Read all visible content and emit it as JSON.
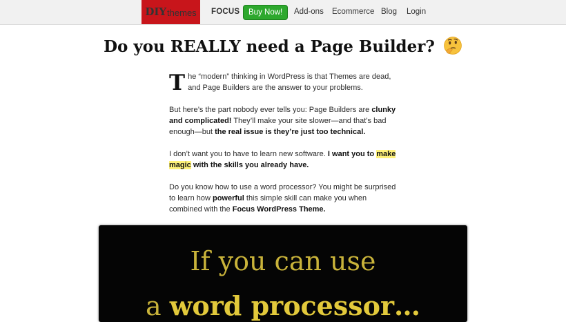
{
  "nav": {
    "logo_diy": "DIY",
    "logo_themes": "themes",
    "focus": "FOCUS",
    "buy_now": "Buy Now!",
    "addons": "Add-ons",
    "ecommerce": "Ecommerce",
    "blog": "Blog",
    "login": "Login",
    "buy_color": "#2da82d",
    "logo_color": "#c8151b"
  },
  "headline": "Do you REALLY need a Page Builder?",
  "headline_icon": "thinking-face-emoji",
  "p1": {
    "dropcap": "T",
    "text": "he “modern” thinking in WordPress is that Themes are dead, and Page Builders are the answer to your problems."
  },
  "p2": {
    "a": "But here’s the part nobody ever tells you: Page Builders are ",
    "b": "clunky and complicated!",
    "c": " They’ll make your site slower—and that’s bad enough—but ",
    "d": "the real issue is they’re just too technical."
  },
  "p3": {
    "a": "I don’t want you to have to learn new software. ",
    "b": "I want you to ",
    "c": "make magic",
    "d": " with the skills you already have."
  },
  "p4": {
    "a": "Do you know how to use a word processor? You might be surprised to learn how ",
    "b": "powerful",
    "c": " this simple skill can make you when combined with the ",
    "d": "Focus WordPress Theme."
  },
  "video": {
    "line1": "If you can use",
    "line2_a": "a ",
    "line2_b": "word processor…"
  },
  "highlight_color": "#fff27a"
}
